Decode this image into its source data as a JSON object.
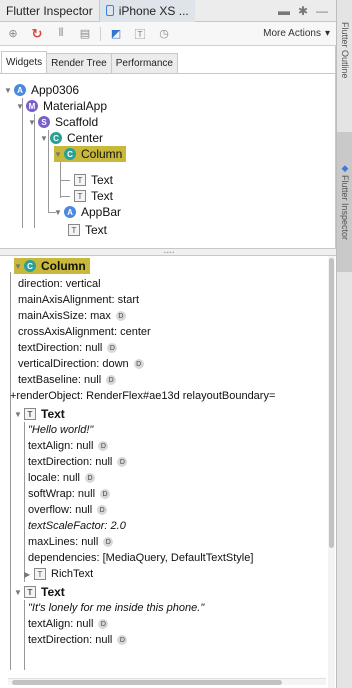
{
  "titlebar": {
    "tab1": "Flutter Inspector",
    "tab2": "iPhone XS ...",
    "icons": [
      "comment-icon",
      "gear-icon",
      "minimize-icon"
    ]
  },
  "toolbar": {
    "buttons": [
      "toggle-platform-icon",
      "refresh-icon",
      "debug-paint-icon",
      "performance-overlay-icon",
      "select-widget-icon",
      "baseline-icon",
      "slow-animation-icon"
    ],
    "more_actions": "More Actions"
  },
  "tabs": [
    "Widgets",
    "Render Tree",
    "Performance"
  ],
  "right_panel": {
    "tab1": "Flutter Outline",
    "tab2": "Flutter Inspector"
  },
  "tree": [
    {
      "label": "App0306",
      "badge": "A"
    },
    {
      "label": "MaterialApp",
      "badge": "M"
    },
    {
      "label": "Scaffold",
      "badge": "S"
    },
    {
      "label": "Center",
      "badge": "C"
    },
    {
      "label": "Column",
      "badge": "C",
      "selected": true
    },
    {
      "label": "Text",
      "badge": "T"
    },
    {
      "label": "Text",
      "badge": "T"
    },
    {
      "label": "AppBar",
      "badge": "A"
    },
    {
      "label": "Text",
      "badge": "T"
    }
  ],
  "properties": {
    "header": "Column",
    "items": [
      {
        "text": "direction: vertical"
      },
      {
        "text": "mainAxisAlignment: start"
      },
      {
        "text": "mainAxisSize: max",
        "d": true
      },
      {
        "text": "crossAxisAlignment: center"
      },
      {
        "text": "textDirection: null",
        "d": true
      },
      {
        "text": "verticalDirection: down",
        "d": true
      },
      {
        "text": "textBaseline: null",
        "d": true
      },
      {
        "text": "+renderObject: RenderFlex#ae13d relayoutBoundary="
      },
      {
        "text": "Text",
        "header": true
      },
      {
        "text": "\"Hello world!\"",
        "italic": true
      },
      {
        "text": "textAlign: null",
        "d": true
      },
      {
        "text": "textDirection: null",
        "d": true
      },
      {
        "text": "locale: null",
        "d": true
      },
      {
        "text": "softWrap: null",
        "d": true
      },
      {
        "text": "overflow: null",
        "d": true
      },
      {
        "text": "textScaleFactor: 2.0",
        "italic": true
      },
      {
        "text": "maxLines: null",
        "d": true
      },
      {
        "text": "dependencies: [MediaQuery, DefaultTextStyle]"
      },
      {
        "text": "RichText",
        "header": true
      },
      {
        "text": "Text",
        "header": true
      },
      {
        "text": "\"It's lonely for me inside this phone.\"",
        "italic": true
      },
      {
        "text": "textAlign: null",
        "d": true
      },
      {
        "text": "textDirection: null",
        "d": true
      }
    ]
  },
  "colors": {
    "selected_bg": "#c9b93a",
    "accent": "#3c82dc",
    "refresh": "#d9473a"
  }
}
